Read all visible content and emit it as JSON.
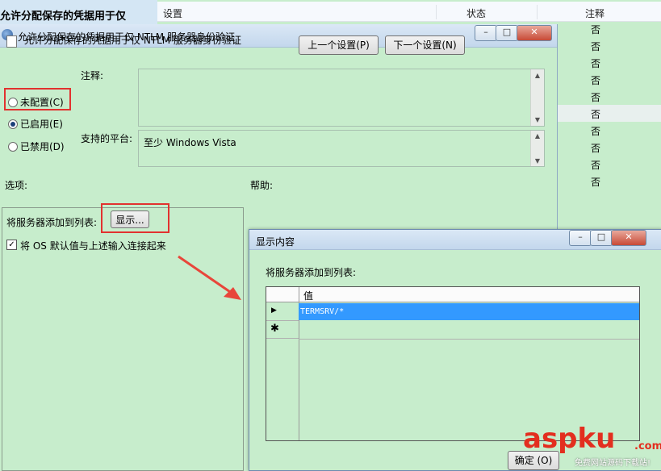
{
  "background": {
    "title": "允许分配保存的凭据用于仅",
    "columns": {
      "setting": "设置",
      "state": "状态",
      "comment": "注释"
    },
    "comment_values": [
      "否",
      "否",
      "否",
      "否",
      "否",
      "否",
      "否",
      "否",
      "否",
      "否"
    ]
  },
  "main_dialog": {
    "title": "允许分配保存的凭据用于仅 NTLM 服务器身份验证",
    "heading": "允许分配保存的凭据用于仅 NTLM 服务器身份验证",
    "prev_button": "上一个设置(P)",
    "next_button": "下一个设置(N)",
    "radios": {
      "not_configured": "未配置(C)",
      "enabled": "已启用(E)",
      "disabled": "已禁用(D)",
      "selected": "enabled"
    },
    "comment_label": "注释:",
    "platform_label": "支持的平台:",
    "platform_value": "至少 Windows Vista",
    "options_label": "选项:",
    "help_label": "帮助:",
    "server_list_label": "将服务器添加到列表:",
    "show_button": "显示...",
    "combine_label": "将 OS 默认值与上述输入连接起来",
    "combine_checked": true
  },
  "show_dialog": {
    "title": "显示内容",
    "list_label": "将服务器添加到列表:",
    "column_header": "值",
    "rows": [
      "TERMSRV/*"
    ],
    "ok_button": "确定 (O)"
  },
  "watermark": {
    "brand": "aspku",
    "suffix": ".com",
    "sub": "免费网站源码下载站!"
  },
  "colors": {
    "background": "#c7edcc",
    "highlight": "#e2322f",
    "selection": "#3399ff"
  }
}
